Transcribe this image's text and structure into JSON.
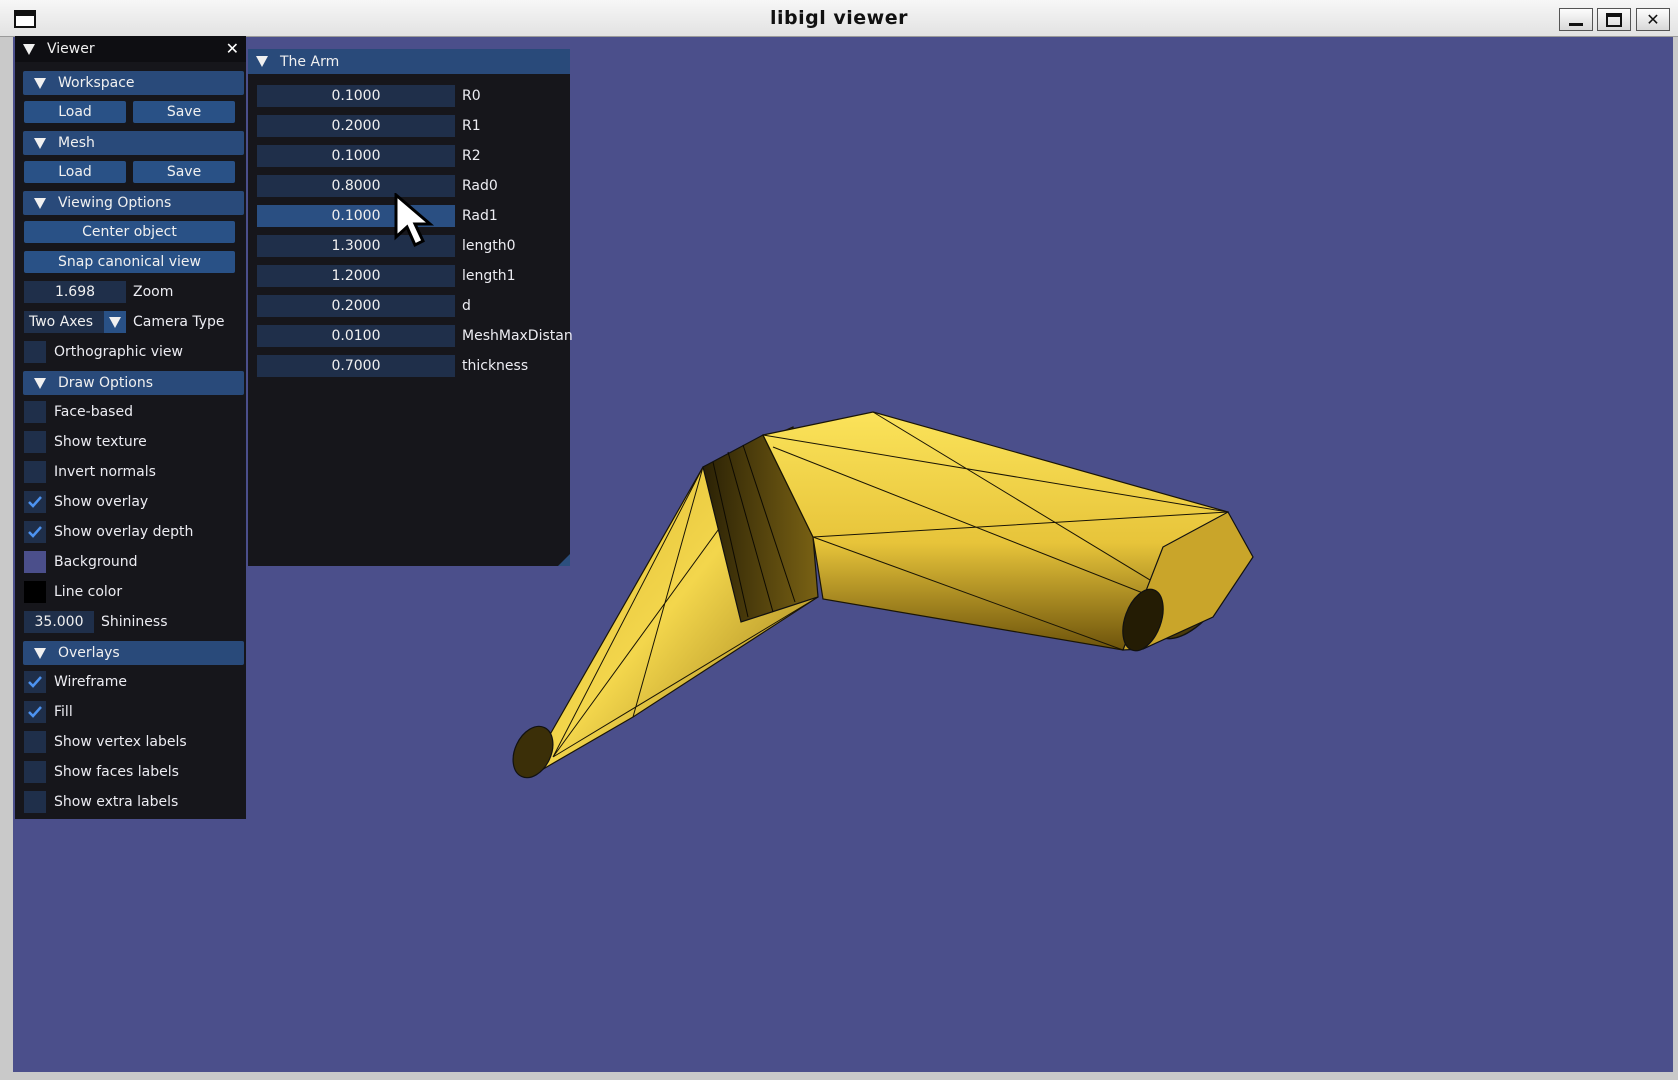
{
  "window": {
    "title": "libigl viewer",
    "controls": [
      "minimize-icon",
      "maximize-icon",
      "close-icon"
    ],
    "close_glyph": "✕"
  },
  "viewport": {
    "background_color": "#4b4f8b",
    "mesh_color": "#e6c23b",
    "wire_color": "#111111"
  },
  "viewer_panel": {
    "title": "Viewer",
    "close_glyph": "✕",
    "workspace": {
      "header": "Workspace",
      "load": "Load",
      "save": "Save"
    },
    "mesh": {
      "header": "Mesh",
      "load": "Load",
      "save": "Save"
    },
    "viewing": {
      "header": "Viewing Options",
      "center_object": "Center object",
      "snap_canonical": "Snap canonical view",
      "zoom_value": "1.698",
      "zoom_label": "Zoom",
      "camera_value": "Two Axes",
      "camera_label": "Camera Type",
      "orthographic_label": "Orthographic view",
      "orthographic_checked": false
    },
    "draw": {
      "header": "Draw Options",
      "face_based": "Face-based",
      "show_texture": "Show texture",
      "invert_normals": "Invert normals",
      "show_overlay": "Show overlay",
      "show_overlay_depth": "Show overlay depth",
      "background": "Background",
      "background_color": "#4b4f8b",
      "line_color": "Line color",
      "line_color_value": "#000000",
      "shininess_value": "35.000",
      "shininess_label": "Shininess",
      "checked": {
        "face_based": false,
        "show_texture": false,
        "invert_normals": false,
        "show_overlay": true,
        "show_overlay_depth": true
      }
    },
    "overlays": {
      "header": "Overlays",
      "wireframe": "Wireframe",
      "fill": "Fill",
      "vertex_labels": "Show vertex labels",
      "faces_labels": "Show faces labels",
      "extra_labels": "Show extra labels",
      "checked": {
        "wireframe": true,
        "fill": true,
        "vertex_labels": false,
        "faces_labels": false,
        "extra_labels": false
      }
    }
  },
  "arm_panel": {
    "title": "The Arm",
    "params": [
      {
        "value": "0.1000",
        "label": "R0"
      },
      {
        "value": "0.2000",
        "label": "R1"
      },
      {
        "value": "0.1000",
        "label": "R2"
      },
      {
        "value": "0.8000",
        "label": "Rad0"
      },
      {
        "value": "0.1000",
        "label": "Rad1"
      },
      {
        "value": "1.3000",
        "label": "length0"
      },
      {
        "value": "1.2000",
        "label": "length1"
      },
      {
        "value": "0.2000",
        "label": "d"
      },
      {
        "value": "0.0100",
        "label": "MeshMaxDistan"
      },
      {
        "value": "0.7000",
        "label": "thickness"
      }
    ]
  }
}
